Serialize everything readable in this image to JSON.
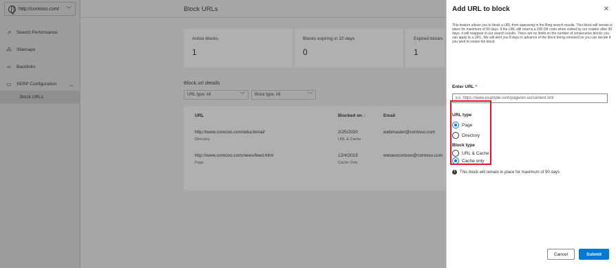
{
  "sidebar": {
    "site": "http://contoso.com/",
    "items": [
      {
        "label": "Search Performance",
        "icon": "trend-icon"
      },
      {
        "label": "Sitemaps",
        "icon": "sitemap-icon"
      },
      {
        "label": "Backlinks",
        "icon": "link-icon"
      },
      {
        "label": "SERP Configuration",
        "icon": "serp-icon"
      },
      {
        "label": "Block URLs"
      }
    ]
  },
  "main": {
    "title": "Block URLs",
    "stats": [
      {
        "label": "Active blocks",
        "value": "1"
      },
      {
        "label": "Blocks expiring in 10 days",
        "value": "0"
      },
      {
        "label": "Expired blocks",
        "value": "1"
      }
    ],
    "details_title": "Block url details",
    "filters": [
      "URL type: All",
      "Block type: All"
    ],
    "table": {
      "headers": [
        "URL",
        "Blocked on ↓",
        "Email"
      ],
      "rows": [
        {
          "url": "http://www.contoso.com/eductional/",
          "url_type": "Directory",
          "date": "2/25/2020",
          "block": "URL & Cache",
          "email": "webmaster@contoso.com"
        },
        {
          "url": "http://www.contoso.com/news/feed.html",
          "url_type": "Page",
          "date": "12/4/2019",
          "block": "Cache Only",
          "email": "wwseocontoso@contoso.com"
        }
      ]
    }
  },
  "panel": {
    "title": "Add URL to block",
    "close": "✕",
    "description": "This feature allows you to block a URL from appearing in the Bing search results. This block will remain in place for maximum of 90 days. If the URL still returns a 200 OK code when visited by our crawler after 90 days, it will reappear in our search results. There are no limits on the number of consecutive blocks you can apply to a URL. We will alert you 8 days in advance of the block being removed so you can decide if you wish to renew the block.",
    "enter_url_label": "Enter URL",
    "required_mark": "*",
    "url_placeholder": "Ex. https://www.example.com/page/en-us/content.xml",
    "url_type_label": "URL type",
    "url_type_options": [
      "Page",
      "Directory"
    ],
    "url_type_selected": "Page",
    "block_type_label": "Block type",
    "block_type_options": [
      "URL & Cache",
      "Cache only"
    ],
    "block_type_selected": "Cache only",
    "info_text": "This block will remain in place for maximum of 90 days",
    "cancel": "Cancel",
    "submit": "Submit",
    "accent": "#0078d4",
    "highlight_color": "#e81123"
  }
}
